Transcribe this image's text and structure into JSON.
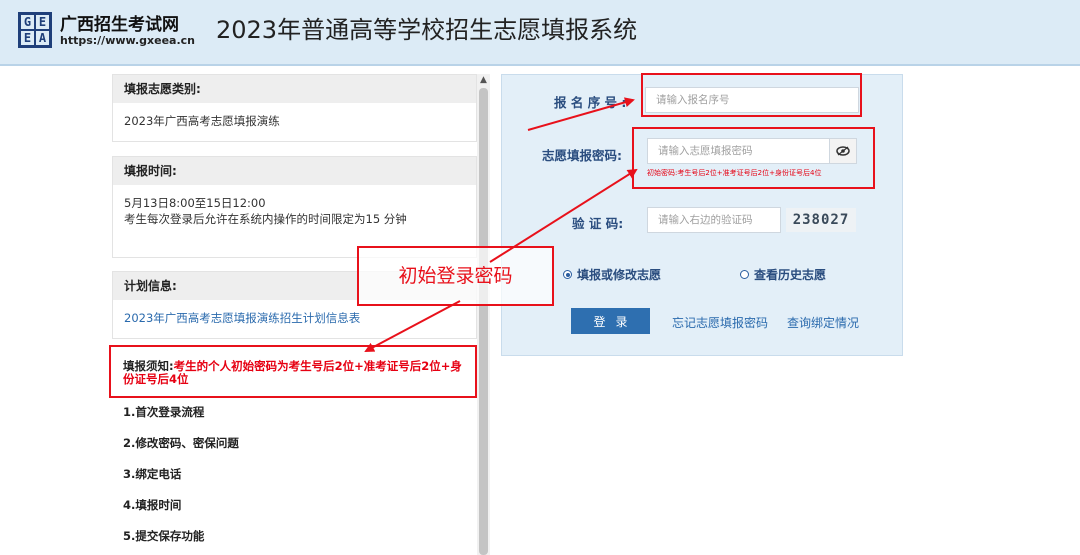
{
  "header": {
    "logo_letters": [
      "G",
      "E",
      "E",
      "A"
    ],
    "site_name": "广西招生考试网",
    "site_url": "https://www.gxeea.cn",
    "system_title": "2023年普通高等学校招生志愿填报系统"
  },
  "left": {
    "category": {
      "title": "填报志愿类别:",
      "value": "2023年广西高考志愿填报演练"
    },
    "time": {
      "title": "填报时间:",
      "line1": "5月13日8:00至15日12:00",
      "line2": "考生每次登录后允许在系统内操作的时间限定为15 分钟"
    },
    "plan": {
      "title": "计划信息:",
      "link": "2023年广西高考志愿填报演练招生计划信息表"
    },
    "notice": {
      "label": "填报须知:",
      "text": "考生的个人初始密码为考生号后2位+准考证号后2位+身份证号后4位",
      "items": [
        "1.首次登录流程",
        "2.修改密码、密保问题",
        "3.绑定电话",
        "4.填报时间",
        "5.提交保存功能"
      ]
    }
  },
  "login": {
    "reg_label": "报 名 序 号 :",
    "reg_placeholder": "请输入报名序号",
    "pwd_label": "志愿填报密码:",
    "pwd_placeholder": "请输入志愿填报密码",
    "pwd_hint": "初始密码:考生号后2位+准考证号后2位+身份证号后4位",
    "code_label": "验 证 码:",
    "code_placeholder": "请输入右边的验证码",
    "captcha_text": "238027",
    "radio_fill": "填报或修改志愿",
    "radio_history": "查看历史志愿",
    "login_button": "登录",
    "forgot_link": "忘记志愿填报密码",
    "binding_link": "查询绑定情况"
  },
  "annotation": {
    "label": "初始登录密码",
    "color": "#e8111b"
  }
}
